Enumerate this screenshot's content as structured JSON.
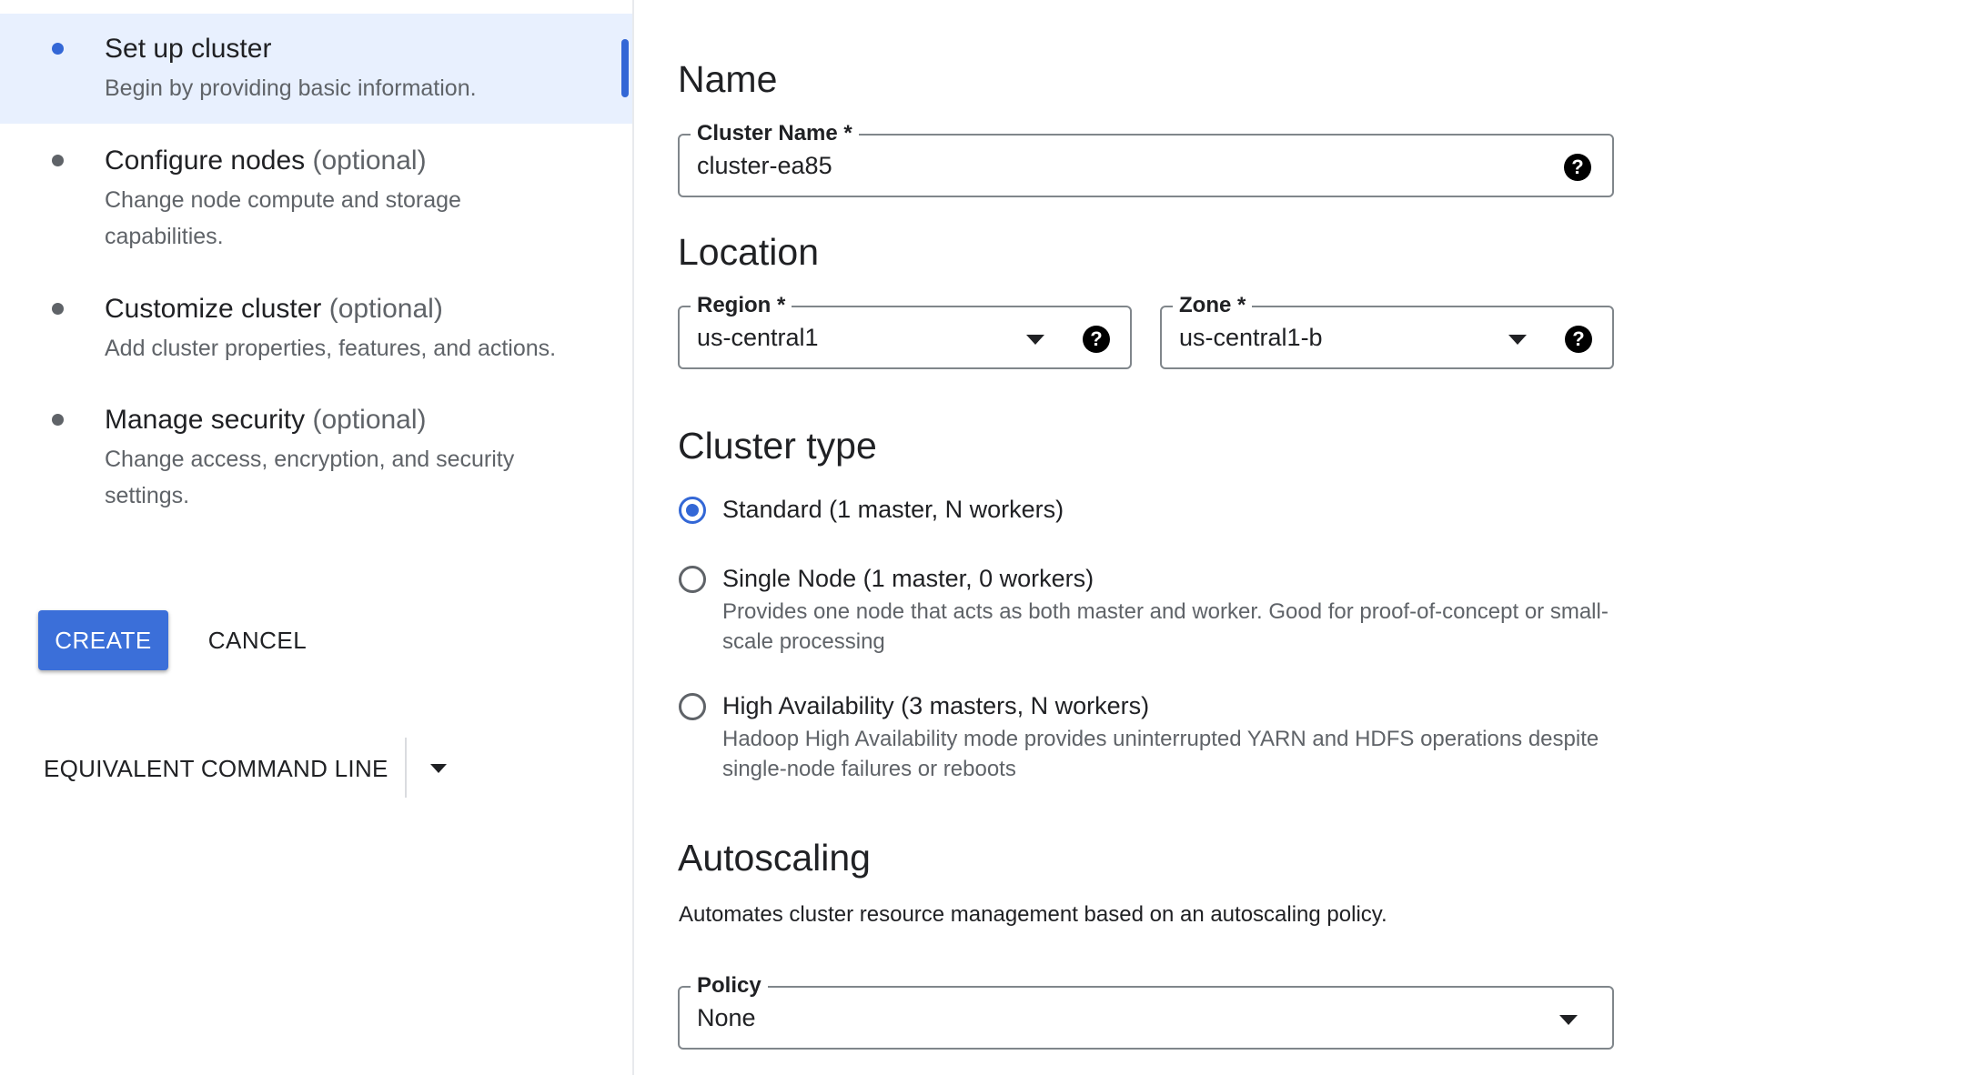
{
  "steps": [
    {
      "title": "Set up cluster",
      "optional": "",
      "description": "Begin by providing basic information."
    },
    {
      "title": "Configure nodes",
      "optional": "(optional)",
      "description": "Change node compute and storage capabilities."
    },
    {
      "title": "Customize cluster",
      "optional": "(optional)",
      "description": "Add cluster properties, features, and actions."
    },
    {
      "title": "Manage security",
      "optional": "(optional)",
      "description": "Change access, encryption, and security settings."
    }
  ],
  "actions": {
    "create_label": "CREATE",
    "cancel_label": "CANCEL",
    "command_line_label": "EQUIVALENT COMMAND LINE"
  },
  "name_section": {
    "title": "Name",
    "cluster_name_label": "Cluster Name *",
    "cluster_name_value": "cluster-ea85"
  },
  "location_section": {
    "title": "Location",
    "region_label": "Region *",
    "region_value": "us-central1",
    "zone_label": "Zone *",
    "zone_value": "us-central1-b"
  },
  "cluster_type_section": {
    "title": "Cluster type",
    "options": [
      {
        "label": "Standard (1 master, N workers)",
        "description": "",
        "selected": true
      },
      {
        "label": "Single Node (1 master, 0 workers)",
        "description": "Provides one node that acts as both master and worker. Good for proof-of-concept or small-scale processing",
        "selected": false
      },
      {
        "label": "High Availability (3 masters, N workers)",
        "description": "Hadoop High Availability mode provides uninterrupted YARN and HDFS operations despite single-node failures or reboots",
        "selected": false
      }
    ]
  },
  "autoscaling_section": {
    "title": "Autoscaling",
    "description": "Automates cluster resource management based on an autoscaling policy.",
    "policy_label": "Policy",
    "policy_value": "None"
  },
  "colors": {
    "accent": "#3367d6",
    "active_step_bg": "#e8f0fe",
    "create_button": "#3b6fd9"
  },
  "icons": {
    "help": "question-circle-icon",
    "dropdown": "caret-down-icon"
  }
}
